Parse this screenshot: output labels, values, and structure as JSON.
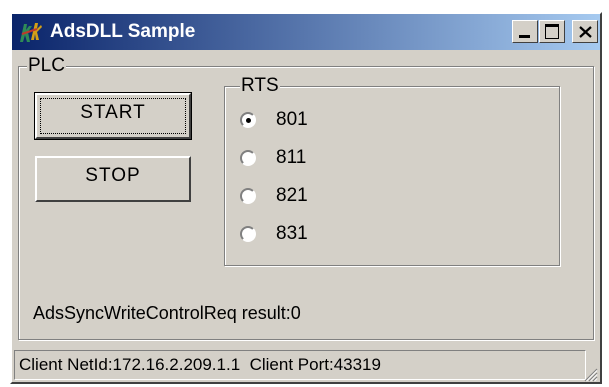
{
  "window": {
    "title": "AdsDLL Sample",
    "icon": "app-icon",
    "controls": [
      "minimize-icon",
      "maximize-icon",
      "close-icon"
    ]
  },
  "plc_group": {
    "label": "PLC",
    "start_label": "START",
    "stop_label": "STOP"
  },
  "rts_group": {
    "label": "RTS",
    "options": [
      {
        "label": "801",
        "selected": true
      },
      {
        "label": "811",
        "selected": false
      },
      {
        "label": "821",
        "selected": false
      },
      {
        "label": "831",
        "selected": false
      }
    ]
  },
  "result_text": "AdsSyncWriteControlReq result:0",
  "status_bar": {
    "text": "Client NetId:172.16.2.209.1.1  Client Port:43319"
  },
  "colors": {
    "face": "#d4d0c8",
    "title_start": "#0a246a",
    "title_end": "#a6caf0"
  }
}
